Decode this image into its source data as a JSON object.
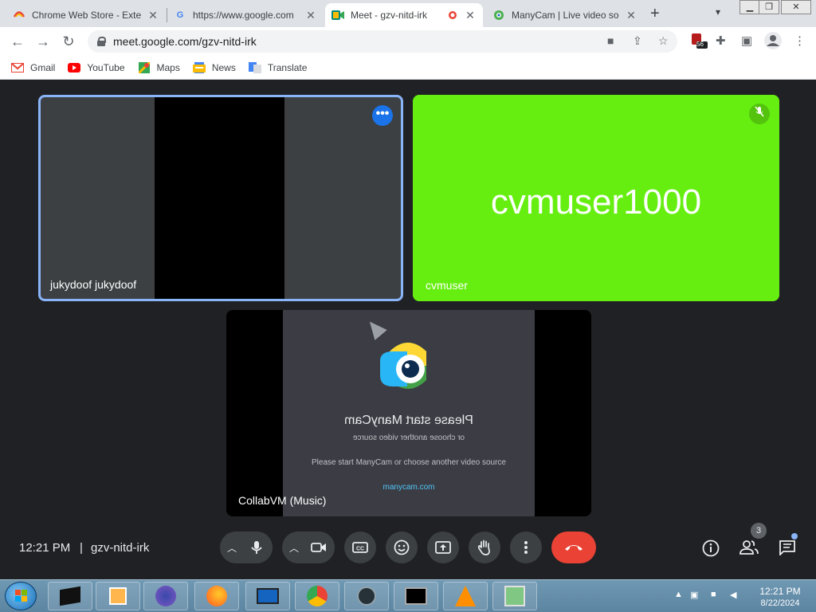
{
  "browser": {
    "tabs": [
      {
        "title": "Chrome Web Store - Exte",
        "icon": "chrome-web-store-icon",
        "active": false
      },
      {
        "title": "https://www.google.com",
        "icon": "google-icon",
        "active": false
      },
      {
        "title": "Meet - gzv-nitd-irk",
        "icon": "meet-icon",
        "active": true
      },
      {
        "title": "ManyCam | Live video so",
        "icon": "manycam-icon",
        "active": false
      }
    ],
    "new_tab": "+",
    "address": "meet.google.com/gzv-nitd-irk",
    "extension_badge": "56"
  },
  "bookmarks": [
    {
      "label": "Gmail",
      "icon": "gmail-icon"
    },
    {
      "label": "YouTube",
      "icon": "youtube-icon"
    },
    {
      "label": "Maps",
      "icon": "maps-icon"
    },
    {
      "label": "News",
      "icon": "news-icon"
    },
    {
      "label": "Translate",
      "icon": "translate-icon"
    }
  ],
  "meet": {
    "participants": [
      {
        "name": "jukydoof jukydoof"
      },
      {
        "name": "cvmuser",
        "display": "cvmuser1000"
      },
      {
        "name": "CollabVM (Music)"
      }
    ],
    "manycam": {
      "mirrored_title": "Please start ManyCam",
      "mirrored_sub": "or choose another video source",
      "message": "Please start ManyCam or choose another video source",
      "link": "manycam.com"
    },
    "time": "12:21 PM",
    "separator": "|",
    "meeting_code": "gzv-nitd-irk",
    "people_count": "3"
  },
  "taskbar": {
    "time": "12:21 PM",
    "date": "8/22/2024"
  },
  "colors": {
    "meet_bg": "#202124",
    "active_border": "#8ab4f8",
    "green_tile": "#66ee11",
    "leave_red": "#ea4335"
  }
}
